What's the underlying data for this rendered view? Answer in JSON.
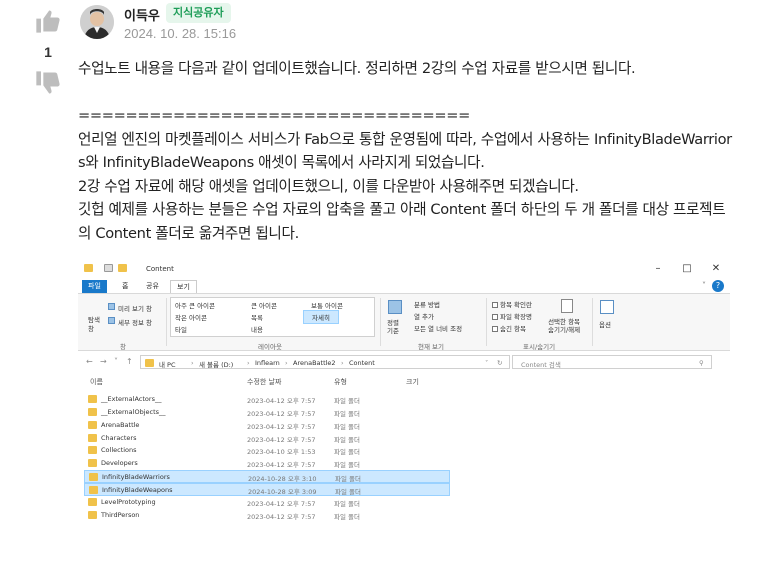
{
  "vote": {
    "count": "1"
  },
  "post": {
    "author": "이득우",
    "badge": "지식공유자",
    "date": "2024. 10. 28. 15:16",
    "paragraph1": "수업노트 내용을 다음과 같이 업데이트했습니다. 정리하면 2강의 수업 자료를 받으시면 됩니다.",
    "divider": "=================================",
    "paragraph2": "언리얼 엔진의 마켓플레이스 서비스가 Fab으로 통합 운영됨에 따라, 수업에서 사용하는 InfinityBladeWarriors와 InfinityBladeWeapons 애셋이 목록에서 사라지게 되었습니다.",
    "paragraph3": "2강 수업 자료에 해당 애셋을 업데이트했으니, 이를 다운받아 사용해주면 되겠습니다.",
    "paragraph4": "깃헙 예제를 사용하는 분들은 수업 자료의 압축을 풀고 아래 Content 폴더 하단의 두 개 폴더를 대상 프로젝트의 Content 폴더로 옮겨주면 됩니다."
  },
  "explorer": {
    "title": "Content",
    "menu": {
      "file": "파일",
      "home": "홈",
      "share": "공유",
      "view": "보기"
    },
    "ribbon": {
      "preview_pane": "미리 보기 창",
      "details_pane": "세부 정보 창",
      "nav_pane": "탐색\n창",
      "pane_group": "창",
      "xl_icons": "아주 큰 아이콘",
      "l_icons": "큰 아이콘",
      "m_icons": "보통 아이콘",
      "s_icons": "작은 아이콘",
      "list": "목록",
      "details": "자세히",
      "tiles": "타일",
      "content": "내용",
      "layout_group": "레이아웃",
      "sort_by": "정렬\n기준",
      "group_by": "분류 방법",
      "add_column": "열 추가",
      "fit_columns": "모든 열 너비 조정",
      "current_view_group": "현재 보기",
      "item_checkboxes": "항목 확인란",
      "file_ext": "파일 확장명",
      "hidden_items": "숨긴 항목",
      "hide_selected": "선택한 항목\n숨기기/해제",
      "show_hide_group": "표시/숨기기",
      "options": "옵션"
    },
    "breadcrumb": [
      "내 PC",
      "새 볼륨 (D:)",
      "Inflearn",
      "ArenaBattle2",
      "Content"
    ],
    "search_placeholder": "Content 검색",
    "columns": {
      "name": "이름",
      "date": "수정한 날짜",
      "type": "유형",
      "size": "크기"
    },
    "files": [
      {
        "name": "__ExternalActors__",
        "date": "2023-04-12 오후 7:57",
        "type": "파일 폴더",
        "selected": false
      },
      {
        "name": "__ExternalObjects__",
        "date": "2023-04-12 오후 7:57",
        "type": "파일 폴더",
        "selected": false
      },
      {
        "name": "ArenaBattle",
        "date": "2023-04-12 오후 7:57",
        "type": "파일 폴더",
        "selected": false
      },
      {
        "name": "Characters",
        "date": "2023-04-12 오후 7:57",
        "type": "파일 폴더",
        "selected": false
      },
      {
        "name": "Collections",
        "date": "2023-04-10 오후 1:53",
        "type": "파일 폴더",
        "selected": false
      },
      {
        "name": "Developers",
        "date": "2023-04-12 오후 7:57",
        "type": "파일 폴더",
        "selected": false
      },
      {
        "name": "InfinityBladeWarriors",
        "date": "2024-10-28 오후 3:10",
        "type": "파일 폴더",
        "selected": true
      },
      {
        "name": "InfinityBladeWeapons",
        "date": "2024-10-28 오후 3:09",
        "type": "파일 폴더",
        "selected": true
      },
      {
        "name": "LevelPrototyping",
        "date": "2023-04-12 오후 7:57",
        "type": "파일 폴더",
        "selected": false
      },
      {
        "name": "ThirdPerson",
        "date": "2023-04-12 오후 7:57",
        "type": "파일 폴더",
        "selected": false
      }
    ]
  },
  "colors": {
    "badge_text": "#1e9d58",
    "badge_bg": "#e6f6ec",
    "selection": "#cce8ff",
    "file_tab": "#1979ca"
  }
}
